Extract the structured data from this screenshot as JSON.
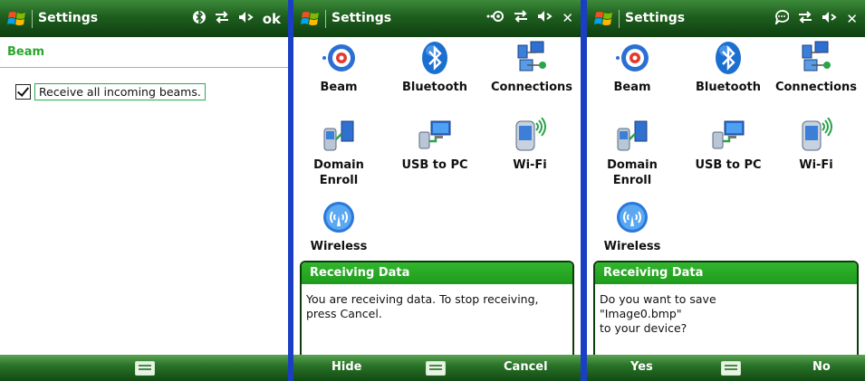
{
  "panels": [
    {
      "title": "Settings",
      "status_icons": [
        "bluetooth-icon",
        "data-sync-icon",
        "volume-icon"
      ],
      "ok_label": "ok",
      "section_title": "Beam",
      "checkbox": {
        "label": "Receive all incoming beams.",
        "checked": true
      },
      "bottom": {
        "keyboard_icon": "keyboard-icon"
      }
    },
    {
      "title": "Settings",
      "status_icons": [
        "beam-signal-icon",
        "data-sync-icon",
        "volume-icon"
      ],
      "close_label": "✕",
      "tiles": [
        {
          "label": "Beam",
          "icon": "beam-icon"
        },
        {
          "label": "Bluetooth",
          "icon": "bluetooth-icon"
        },
        {
          "label": "Connections",
          "icon": "connections-icon"
        },
        {
          "label": "Domain Enroll",
          "line1": "Domain",
          "line2": "Enroll",
          "icon": "domain-enroll-icon"
        },
        {
          "label": "USB to PC",
          "icon": "usb-to-pc-icon"
        },
        {
          "label": "Wi-Fi",
          "icon": "wifi-icon"
        },
        {
          "label": "Wireless",
          "icon": "wireless-icon"
        }
      ],
      "dialog": {
        "title": "Receiving Data",
        "line1": "You are receiving data. To stop receiving,",
        "line2": "press Cancel."
      },
      "bottom": {
        "left_softkey": "Hide",
        "right_softkey": "Cancel"
      }
    },
    {
      "title": "Settings",
      "status_icons": [
        "notification-icon",
        "data-sync-icon",
        "volume-icon"
      ],
      "close_label": "✕",
      "tiles": [
        {
          "label": "Beam",
          "icon": "beam-icon"
        },
        {
          "label": "Bluetooth",
          "icon": "bluetooth-icon"
        },
        {
          "label": "Connections",
          "icon": "connections-icon"
        },
        {
          "label": "Domain Enroll",
          "line1": "Domain",
          "line2": "Enroll",
          "icon": "domain-enroll-icon"
        },
        {
          "label": "USB to PC",
          "icon": "usb-to-pc-icon"
        },
        {
          "label": "Wi-Fi",
          "icon": "wifi-icon"
        },
        {
          "label": "Wireless",
          "icon": "wireless-icon"
        }
      ],
      "dialog": {
        "title": "Receiving Data",
        "line1": "Do you want to save",
        "line2": "\"Image0.bmp\"",
        "line3": "to your device?"
      },
      "bottom": {
        "left_softkey": "Yes",
        "right_softkey": "No"
      }
    }
  ],
  "colors": {
    "title_bar": "#1e5e1e",
    "accent_green": "#27a82a",
    "dialog_title": "#1e9b1c",
    "divider_blue": "#1a3fc4"
  }
}
